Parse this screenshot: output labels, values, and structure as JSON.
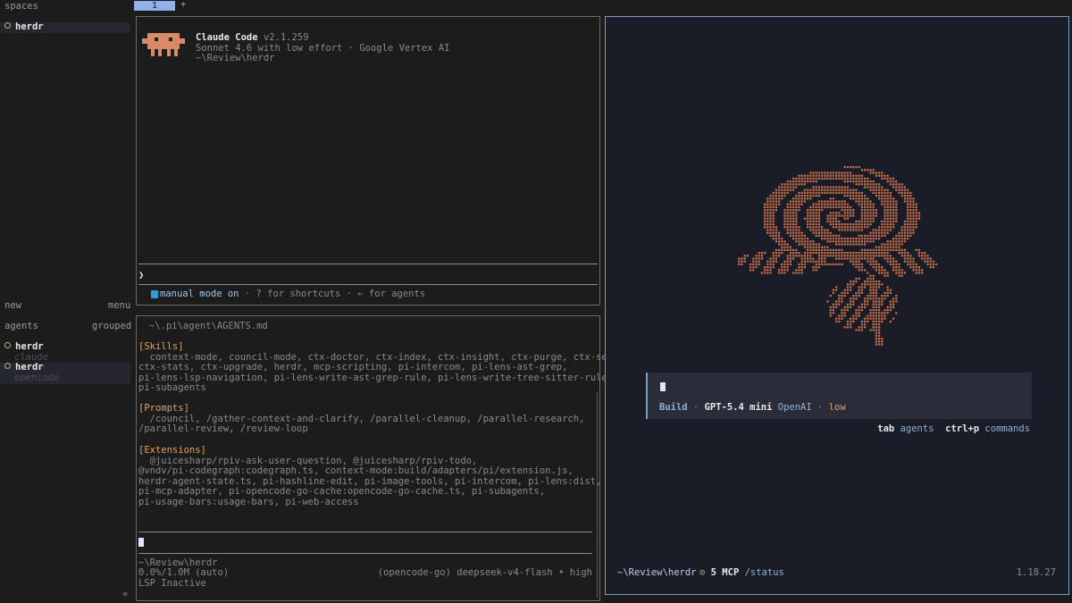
{
  "sidebar": {
    "spaces_header": "spaces",
    "spaces": [
      {
        "name": "herdr"
      }
    ],
    "new_label": "new",
    "menu_label": "menu",
    "agents_header": "agents",
    "grouped_label": "grouped",
    "agents": [
      {
        "name": "herdr",
        "sub": "claude"
      },
      {
        "name": "herdr",
        "sub": "opencode"
      }
    ],
    "collapse_glyph": "«"
  },
  "tabbar": {
    "tabs": [
      {
        "label": "1"
      }
    ],
    "add_label": "+"
  },
  "claude_pane": {
    "app_name": "Claude Code",
    "version": "v2.1.259",
    "model_line": "Sonnet 4.6 with low effort · Google Vertex AI",
    "path": "~\\Review\\herdr",
    "prompt_glyph": "❯",
    "status_mode": "manual mode on",
    "status_rest": " · ? for shortcuts · ← for agents",
    "mascot_color": "#d98a69"
  },
  "pi_pane": {
    "agents_file": "~\\.pi\\agent\\AGENTS.md",
    "skills_header": "[Skills]",
    "skills_lines": [
      "  context-mode, council-mode, ctx-doctor, ctx-index, ctx-insight, ctx-purge, ctx-search,",
      "ctx-stats, ctx-upgrade, herdr, mcp-scripting, pi-intercom, pi-lens-ast-grep,",
      "pi-lens-lsp-navigation, pi-lens-write-ast-grep-rule, pi-lens-write-tree-sitter-rule,",
      "pi-subagents"
    ],
    "prompts_header": "[Prompts]",
    "prompts_lines": [
      "  /council, /gather-context-and-clarify, /parallel-cleanup, /parallel-research,",
      "/parallel-review, /review-loop"
    ],
    "extensions_header": "[Extensions]",
    "extensions_lines": [
      "  @juicesharp/rpiv-ask-user-question, @juicesharp/rpiv-todo,",
      "@vndv/pi-codegraph:codegraph.ts, context-mode:build/adapters/pi/extension.js,",
      "herdr-agent-state.ts, pi-hashline-edit, pi-image-tools, pi-intercom, pi-lens:dist,",
      "pi-mcp-adapter, pi-opencode-go-cache:opencode-go-cache.ts, pi-subagents,",
      "pi-usage-bars:usage-bars, pi-web-access"
    ],
    "footer_path": "~\\Review\\herdr",
    "usage": "0.0%/1.0M (auto)",
    "model": "(opencode-go) deepseek-v4-flash • high",
    "lsp": "LSP Inactive"
  },
  "opencode_pane": {
    "mode": "Build",
    "sep1": " · ",
    "model": "GPT-5.4 mini",
    "provider": "OpenAI",
    "sep2": " · ",
    "effort": "low",
    "hint_tab_key": "tab",
    "hint_tab": "agents",
    "hint_cmd_key": "ctrl+p",
    "hint_cmd": "commands",
    "footer_path": "~\\Review\\herdr",
    "mcp_glyph": "⊙",
    "mcp": "5 MCP",
    "status_cmd": "/status",
    "version": "1.18.27",
    "rose_color": "#c9704a"
  }
}
